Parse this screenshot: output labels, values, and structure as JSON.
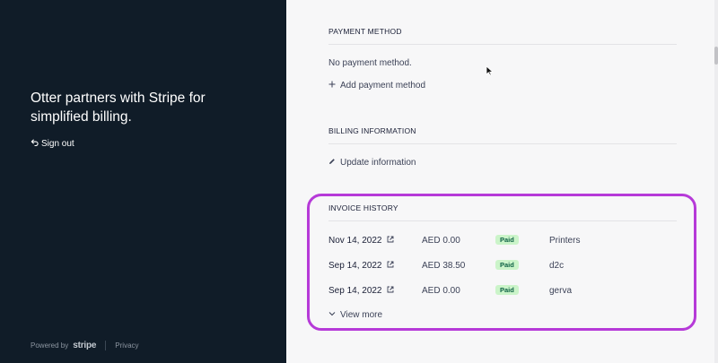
{
  "left": {
    "tagline": "Otter partners with Stripe for simplified billing.",
    "sign_out": "Sign out",
    "footer": {
      "powered_by": "Powered by",
      "brand": "stripe",
      "privacy": "Privacy"
    }
  },
  "payment": {
    "title": "PAYMENT METHOD",
    "empty": "No payment method.",
    "add_label": "Add payment method"
  },
  "billing": {
    "title": "BILLING INFORMATION",
    "update_label": "Update information"
  },
  "invoices": {
    "title": "INVOICE HISTORY",
    "rows": [
      {
        "date": "Nov 14, 2022",
        "amount": "AED 0.00",
        "status": "Paid",
        "description": "Printers"
      },
      {
        "date": "Sep 14, 2022",
        "amount": "AED 38.50",
        "status": "Paid",
        "description": "d2c"
      },
      {
        "date": "Sep 14, 2022",
        "amount": "AED 0.00",
        "status": "Paid",
        "description": "gerva"
      }
    ],
    "view_more": "View more"
  },
  "colors": {
    "left_bg": "#101c28",
    "highlight": "#b63ad8",
    "paid_bg": "#cbf4c9",
    "paid_text": "#0e6245"
  }
}
